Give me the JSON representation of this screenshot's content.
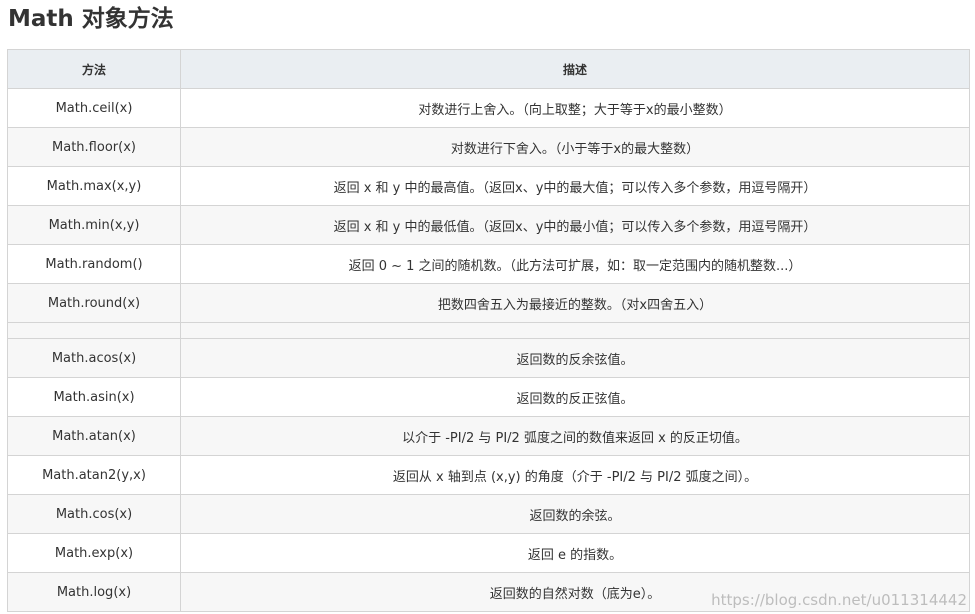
{
  "title": "Math 对象方法",
  "table": {
    "headers": [
      "方法",
      "描述"
    ],
    "rows": [
      {
        "method": "Math.ceil(x)",
        "desc": "对数进行上舍入。（向上取整；大于等于x的最小整数）"
      },
      {
        "method": "Math.floor(x)",
        "desc": "对数进行下舍入。（小于等于x的最大整数）"
      },
      {
        "method": "Math.max(x,y)",
        "desc": "返回 x 和 y 中的最高值。（返回x、y中的最大值；可以传入多个参数，用逗号隔开）"
      },
      {
        "method": "Math.min(x,y)",
        "desc": "返回 x 和 y 中的最低值。（返回x、y中的最小值；可以传入多个参数，用逗号隔开）"
      },
      {
        "method": "Math.random()",
        "desc": "返回 0 ~ 1 之间的随机数。（此方法可扩展，如：取一定范围内的随机整数...）"
      },
      {
        "method": "Math.round(x)",
        "desc": "把数四舍五入为最接近的整数。（对x四舍五入）"
      },
      {
        "method": "",
        "desc": ""
      },
      {
        "method": "Math.acos(x)",
        "desc": "返回数的反余弦值。"
      },
      {
        "method": "Math.asin(x)",
        "desc": "返回数的反正弦值。"
      },
      {
        "method": "Math.atan(x)",
        "desc": "以介于 -PI/2 与 PI/2 弧度之间的数值来返回 x 的反正切值。"
      },
      {
        "method": "Math.atan2(y,x)",
        "desc": "返回从 x 轴到点 (x,y) 的角度（介于 -PI/2 与 PI/2 弧度之间）。"
      },
      {
        "method": "Math.cos(x)",
        "desc": "返回数的余弦。"
      },
      {
        "method": "Math.exp(x)",
        "desc": "返回 e 的指数。"
      },
      {
        "method": "Math.log(x)",
        "desc": "返回数的自然对数（底为e）。"
      }
    ]
  },
  "watermark": "https://blog.csdn.net/u011314442"
}
